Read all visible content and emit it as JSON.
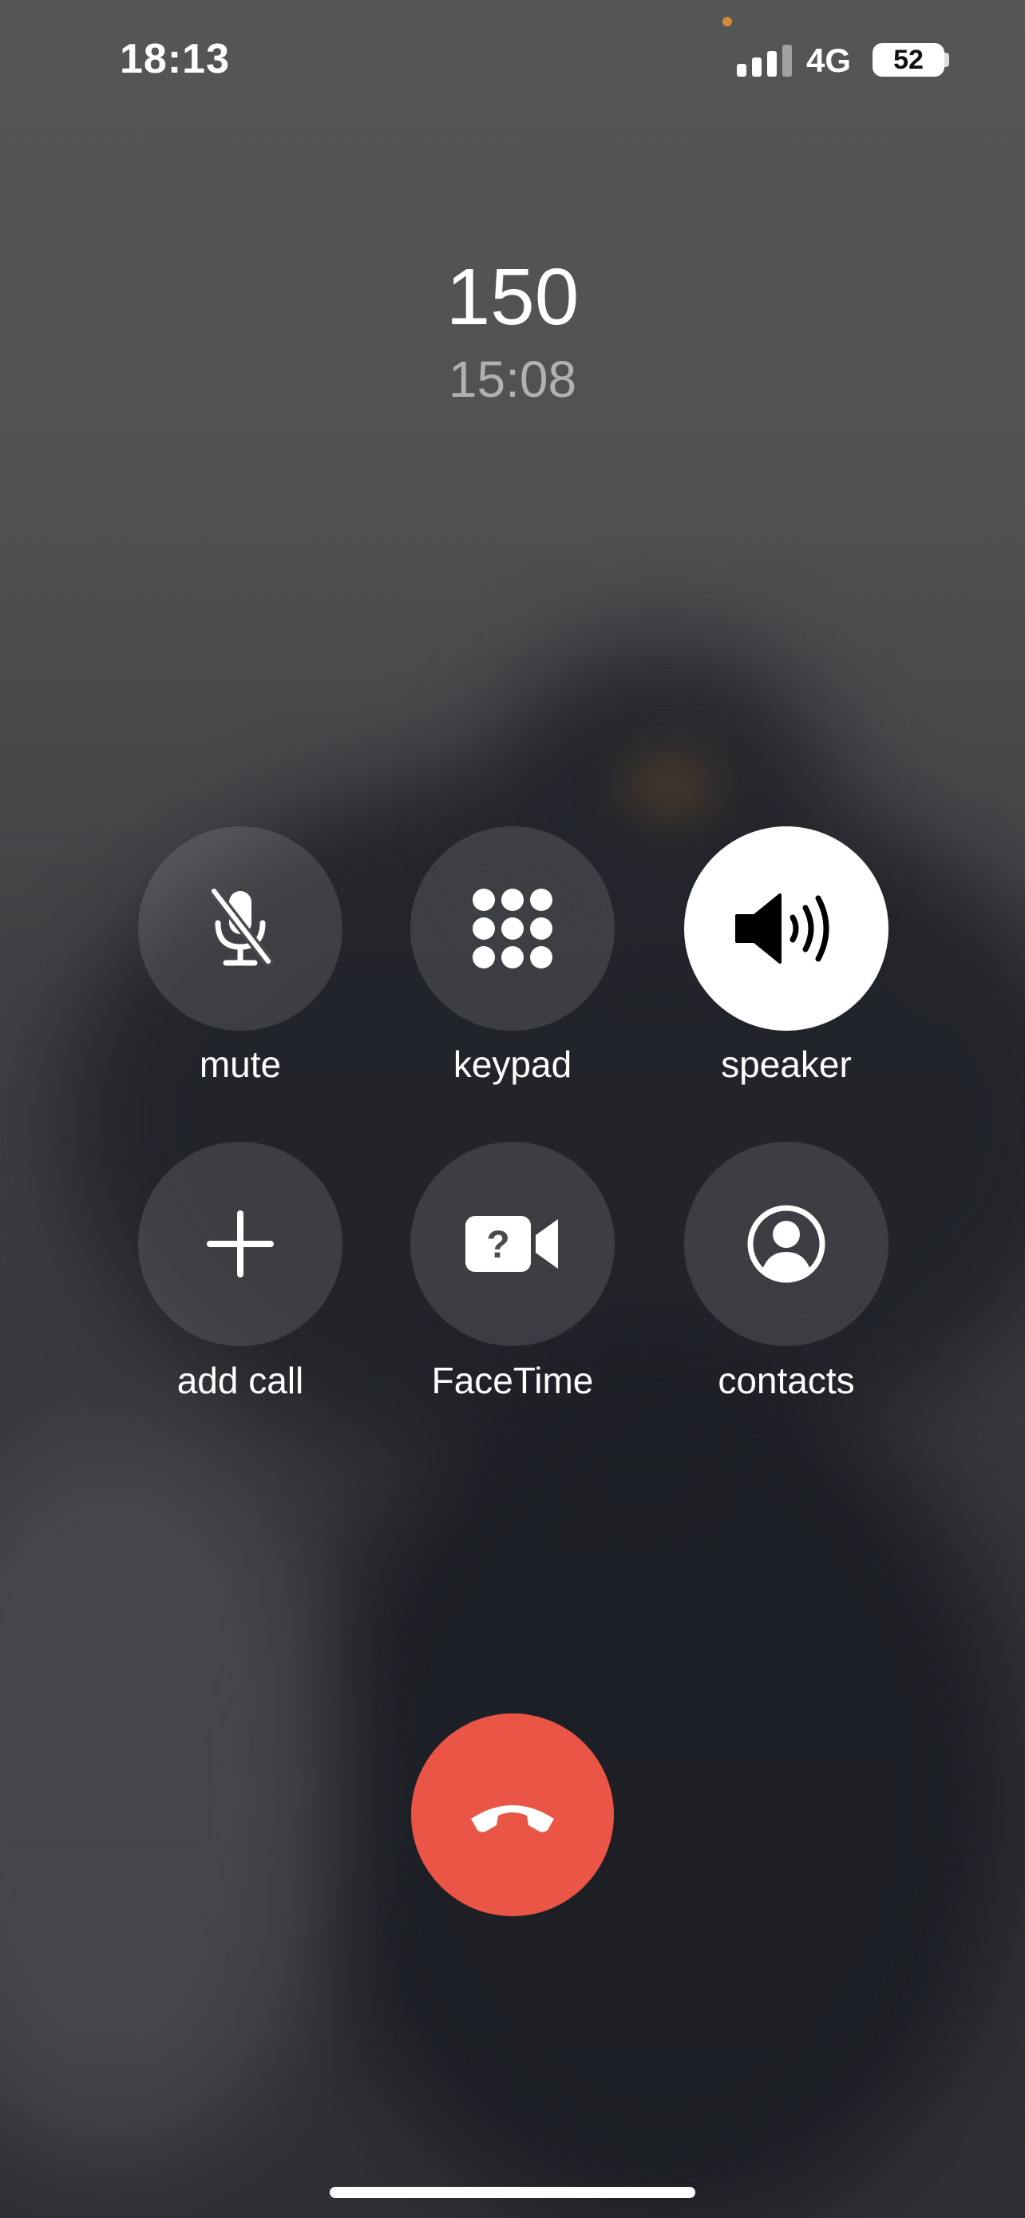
{
  "status_bar": {
    "time": "18:13",
    "network": "4G",
    "battery": "52",
    "signal_bars_filled": 3,
    "signal_bars_total": 4
  },
  "call": {
    "caller": "150",
    "duration": "15:08"
  },
  "controls": {
    "mute": {
      "label": "mute",
      "icon": "mic-slash-icon",
      "active": false
    },
    "keypad": {
      "label": "keypad",
      "icon": "keypad-icon",
      "active": false
    },
    "speaker": {
      "label": "speaker",
      "icon": "speaker-icon",
      "active": true
    },
    "add_call": {
      "label": "add call",
      "icon": "plus-icon",
      "active": false
    },
    "facetime": {
      "label": "FaceTime",
      "icon": "facetime-icon",
      "active": false
    },
    "contacts": {
      "label": "contacts",
      "icon": "person-circle-icon",
      "active": false
    }
  },
  "end_call": {
    "icon": "phone-down-icon",
    "color": "#eb5545"
  },
  "colors": {
    "accent_dot": "#d4893a"
  }
}
